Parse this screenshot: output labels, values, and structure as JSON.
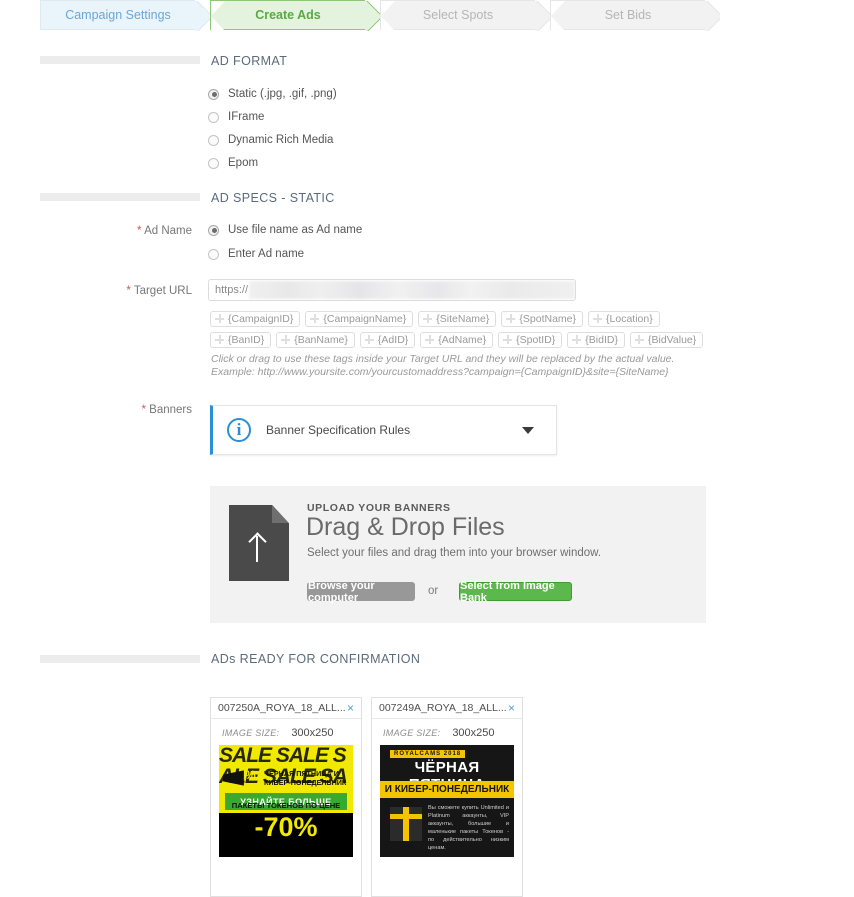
{
  "wizard": {
    "steps": [
      {
        "label": "Campaign Settings",
        "state": "done"
      },
      {
        "label": "Create Ads",
        "state": "active"
      },
      {
        "label": "Select Spots",
        "state": "upcoming"
      },
      {
        "label": "Set Bids",
        "state": "upcoming"
      }
    ]
  },
  "ad_format": {
    "title": "AD FORMAT",
    "options": [
      {
        "label": "Static (.jpg, .gif, .png)",
        "selected": true
      },
      {
        "label": "IFrame",
        "selected": false
      },
      {
        "label": "Dynamic Rich Media",
        "selected": false
      },
      {
        "label": "Epom",
        "selected": false
      }
    ]
  },
  "ad_specs": {
    "title": "AD SPECS - STATIC",
    "ad_name": {
      "label": "Ad Name",
      "required_marker": "*",
      "options": [
        {
          "label": "Use file name as Ad name",
          "selected": true
        },
        {
          "label": "Enter Ad name",
          "selected": false
        }
      ]
    },
    "target_url": {
      "label": "Target URL",
      "required_marker": "*",
      "value": "https://",
      "redacted": true
    },
    "macro_tags": {
      "row1": [
        "{CampaignID}",
        "{CampaignName}",
        "{SiteName}",
        "{SpotName}",
        "{Location}"
      ],
      "row2": [
        "{BanID}",
        "{BanName}",
        "{AdID}",
        "{AdName}",
        "{SpotID}",
        "{BidID}",
        "{BidValue}"
      ]
    },
    "hint_line1": "Click or drag to use these tags inside your Target URL and they will be replaced by the actual value.",
    "hint_line2": "Example: http://www.yoursite.com/yourcustomaddress?campaign={CampaignID}&site={SiteName}",
    "banners": {
      "label": "Banners",
      "required_marker": "*",
      "accordion_title": "Banner Specification Rules",
      "info_glyph": "i",
      "accent_color": "#2a8fd4"
    }
  },
  "upload": {
    "eyebrow": "UPLOAD YOUR BANNERS",
    "title": "Drag & Drop Files",
    "subtitle": "Select your files and drag them into your browser window.",
    "browse_label": "Browse your computer",
    "or_label": "or",
    "image_bank_label": "Select from Image Bank",
    "image_bank_color": "#5cb84c"
  },
  "ads_ready": {
    "title": "ADs READY FOR CONFIRMATION",
    "size_key": "IMAGE SIZE:",
    "cards": [
      {
        "name": "007250A_ROYA_18_ALL...",
        "image_size": "300x250",
        "close_glyph": "×",
        "creative": {
          "style": "yellow-sale",
          "bg_text": "SALE SALE SALE SALE SALE SALE",
          "megaphone_pct": "%",
          "headline_line1": "ЧЁРНАЯ ПЯТНИЦА И",
          "headline_line2": "КИБЕР-ПОНЕДЕЛЬНИК",
          "cta": "УЗНАЙТЕ БОЛЬШЕ",
          "offer_line": "ПАКЕТЫ ТОКЕНОВ ПО ЦЕНЕ",
          "discount": "-70%"
        }
      },
      {
        "name": "007249A_ROYA_18_ALL...",
        "image_size": "300x250",
        "close_glyph": "×",
        "creative": {
          "style": "dark-blackfriday",
          "tag": "ROYALCAMS   2018",
          "title": "ЧЁРНАЯ ПЯТНИЦА",
          "band": "И КИБЕР-ПОНЕДЕЛЬНИК",
          "body": "Вы сможете купить Unlimited и Platinum аккаунты, VIP аккаунты, большие и маленькие пакеты Токенов - по действительно низким ценам."
        }
      }
    ]
  }
}
